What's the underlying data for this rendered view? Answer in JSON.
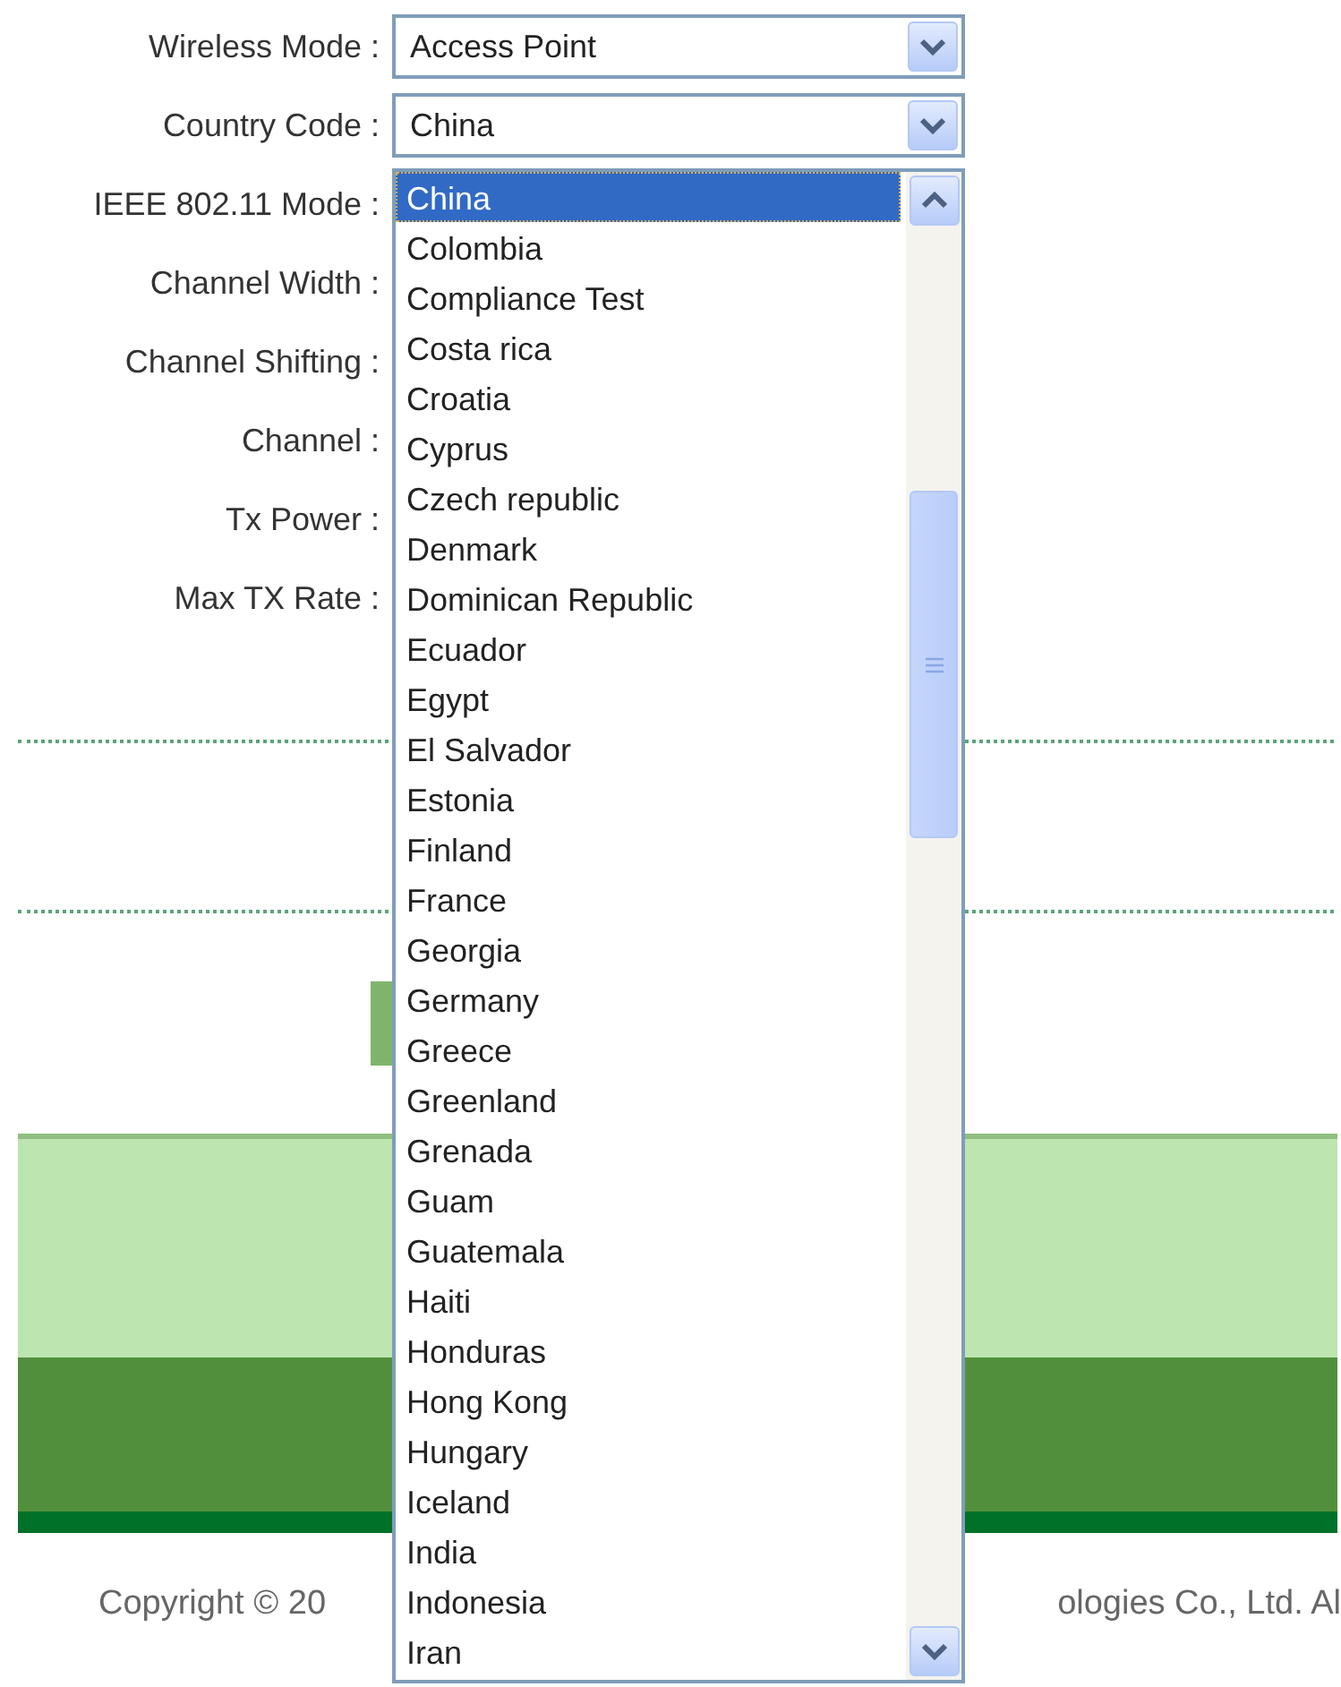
{
  "fields": [
    {
      "label": "Wireless Mode :",
      "value": "Access Point"
    },
    {
      "label": "Country Code :",
      "value": "China"
    },
    {
      "label": "IEEE 802.11 Mode :"
    },
    {
      "label": "Channel Width :"
    },
    {
      "label": "Channel Shifting :"
    },
    {
      "label": "Channel :"
    },
    {
      "label": "Tx Power :"
    },
    {
      "label": "Max TX Rate :"
    }
  ],
  "country_dropdown": {
    "options": [
      {
        "label": "China",
        "selected": true
      },
      {
        "label": "Colombia",
        "selected": false
      },
      {
        "label": "Compliance Test",
        "selected": false
      },
      {
        "label": "Costa rica",
        "selected": false
      },
      {
        "label": "Croatia",
        "selected": false
      },
      {
        "label": "Cyprus",
        "selected": false
      },
      {
        "label": "Czech republic",
        "selected": false
      },
      {
        "label": "Denmark",
        "selected": false
      },
      {
        "label": "Dominican Republic",
        "selected": false
      },
      {
        "label": "Ecuador",
        "selected": false
      },
      {
        "label": "Egypt",
        "selected": false
      },
      {
        "label": "El Salvador",
        "selected": false
      },
      {
        "label": "Estonia",
        "selected": false
      },
      {
        "label": "Finland",
        "selected": false
      },
      {
        "label": "France",
        "selected": false
      },
      {
        "label": "Georgia",
        "selected": false
      },
      {
        "label": "Germany",
        "selected": false
      },
      {
        "label": "Greece",
        "selected": false
      },
      {
        "label": "Greenland",
        "selected": false
      },
      {
        "label": "Grenada",
        "selected": false
      },
      {
        "label": "Guam",
        "selected": false
      },
      {
        "label": "Guatemala",
        "selected": false
      },
      {
        "label": "Haiti",
        "selected": false
      },
      {
        "label": "Honduras",
        "selected": false
      },
      {
        "label": "Hong Kong",
        "selected": false
      },
      {
        "label": "Hungary",
        "selected": false
      },
      {
        "label": "Iceland",
        "selected": false
      },
      {
        "label": "India",
        "selected": false
      },
      {
        "label": "Indonesia",
        "selected": false
      },
      {
        "label": "Iran",
        "selected": false
      }
    ]
  },
  "footer": {
    "copyright_left": "Copyright © 20",
    "copyright_right": "ologies Co., Ltd. Al"
  }
}
